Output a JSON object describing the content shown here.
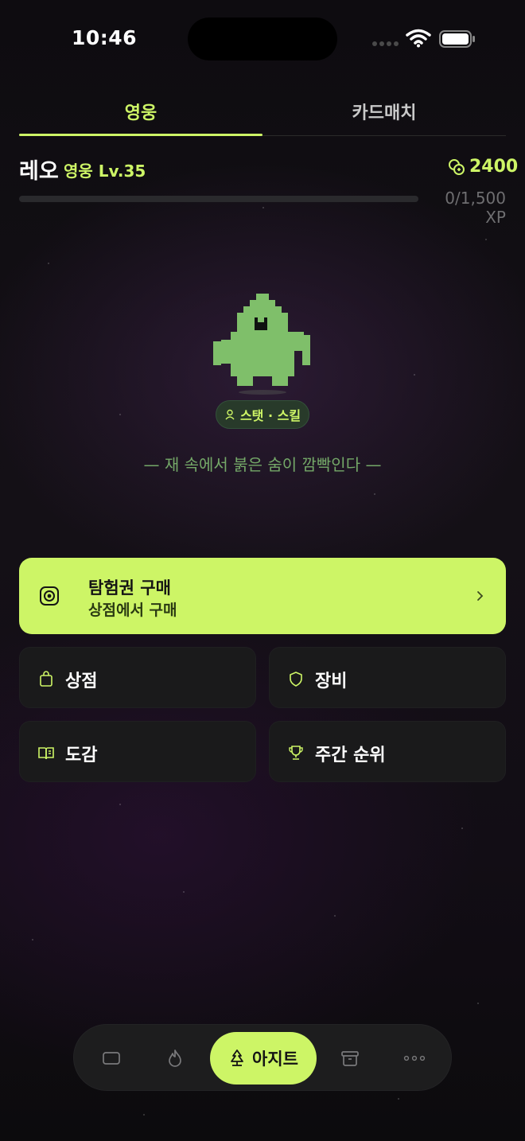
{
  "status_bar": {
    "time": "10:46"
  },
  "tabs": [
    {
      "label": "영웅",
      "active": true
    },
    {
      "label": "카드매치",
      "active": false
    }
  ],
  "hero": {
    "name": "레오",
    "level": "영웅 Lv.35",
    "coins": "2400",
    "xp_text": "0/1,500 XP",
    "xp_progress": 0
  },
  "character": {
    "stat_button": "스탯 · 스킬",
    "flavor_text": "— 재 속에서 붉은 숨이 깜빡인다 —"
  },
  "cta": {
    "title": "탐험권 구매",
    "subtitle": "상점에서 구매",
    "icon": "target-icon"
  },
  "menu": [
    {
      "label": "상점",
      "icon": "shopping-bag-icon"
    },
    {
      "label": "장비",
      "icon": "shield-icon"
    },
    {
      "label": "도감",
      "icon": "book-icon"
    },
    {
      "label": "주간 순위",
      "icon": "trophy-icon"
    }
  ],
  "bottom_nav": {
    "items": [
      "card-icon",
      "flame-icon",
      "tree-icon",
      "archive-icon",
      "more-icon"
    ],
    "active_label": "아지트"
  },
  "colors": {
    "accent": "#cdf566",
    "background": "#0e0c10",
    "tile": "#1a1a1b",
    "character": "#7fbf6a"
  }
}
